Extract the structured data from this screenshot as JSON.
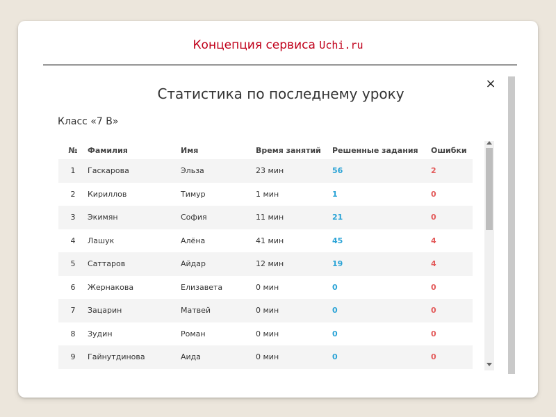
{
  "slide": {
    "title_prefix": "Концепция сервиса ",
    "title_brand": "Uchi.ru"
  },
  "modal": {
    "title": "Статистика по последнему уроку",
    "close_icon": "×",
    "class_label": "Класс «7 В»"
  },
  "table": {
    "headers": [
      "№",
      "Фамилия",
      "Имя",
      "Время занятий",
      "Решенные задания",
      "Ошибки"
    ],
    "rows": [
      {
        "n": "1",
        "surname": "Гаскарова",
        "name": "Эльза",
        "time": "23 мин",
        "solved": "56",
        "errors": "2"
      },
      {
        "n": "2",
        "surname": "Кириллов",
        "name": "Тимур",
        "time": "1 мин",
        "solved": "1",
        "errors": "0"
      },
      {
        "n": "3",
        "surname": "Экимян",
        "name": "София",
        "time": "11 мин",
        "solved": "21",
        "errors": "0"
      },
      {
        "n": "4",
        "surname": "Лашук",
        "name": "Алёна",
        "time": "41 мин",
        "solved": "45",
        "errors": "4"
      },
      {
        "n": "5",
        "surname": "Саттаров",
        "name": "Айдар",
        "time": "12 мин",
        "solved": "19",
        "errors": "4"
      },
      {
        "n": "6",
        "surname": "Жернакова",
        "name": "Елизавета",
        "time": "0 мин",
        "solved": "0",
        "errors": "0"
      },
      {
        "n": "7",
        "surname": "Зацарин",
        "name": "Матвей",
        "time": "0 мин",
        "solved": "0",
        "errors": "0"
      },
      {
        "n": "8",
        "surname": "Зудин",
        "name": "Роман",
        "time": "0 мин",
        "solved": "0",
        "errors": "0"
      },
      {
        "n": "9",
        "surname": "Гайнутдинова",
        "name": "Аида",
        "time": "0 мин",
        "solved": "0",
        "errors": "0"
      }
    ]
  },
  "colors": {
    "title_red": "#c0001a",
    "solved_blue": "#2aa3d6",
    "errors_red": "#e35a5a"
  }
}
